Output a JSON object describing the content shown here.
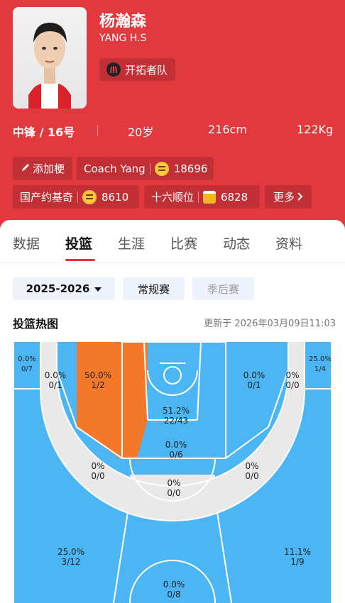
{
  "player": {
    "name_cn": "杨瀚森",
    "name_en": "YANG H.S",
    "team": "开拓者队",
    "position_number": "中锋 / 16号",
    "age": "20岁",
    "height": "216cm",
    "weight": "122Kg"
  },
  "chips": {
    "add_nickname": "添加梗",
    "coach_label": "Coach Yang",
    "coach_count": "18696",
    "nick1_label": "国产约基奇",
    "nick1_count": "8610",
    "nick2_label": "十六顺位",
    "nick2_count": "6828",
    "more": "更多"
  },
  "tabs": [
    "数据",
    "投篮",
    "生涯",
    "比赛",
    "动态",
    "资料"
  ],
  "active_tab": "投篮",
  "season_select": "2025-2026",
  "filters": [
    "常规赛",
    "季后赛"
  ],
  "section_title": "投篮热图",
  "updated": "更新于 2026年03月09日11:03",
  "colors": {
    "header_red": "#e2393f",
    "cold_blue": "#4cb6f5",
    "hot_orange": "#f47829",
    "neutral_gray": "#e9e9e9",
    "line_white": "#ffffff"
  },
  "zones": [
    {
      "id": "left-corner-3",
      "pct": "0.0%",
      "made": "0/7"
    },
    {
      "id": "left-baseline-mid",
      "pct": "0.0%",
      "made": "0/1"
    },
    {
      "id": "left-paint-side",
      "pct": "50.0%",
      "made": "1/2"
    },
    {
      "id": "restricted-area",
      "pct": "51.2%",
      "made": "22/43"
    },
    {
      "id": "right-baseline-mid",
      "pct": "0.0%",
      "made": "0/1"
    },
    {
      "id": "right-mid-corner",
      "pct": "0%",
      "made": "0/0"
    },
    {
      "id": "right-corner-3",
      "pct": "25.0%",
      "made": "1/4"
    },
    {
      "id": "paint-lane",
      "pct": "0.0%",
      "made": "0/6"
    },
    {
      "id": "left-elbow-mid",
      "pct": "0%",
      "made": "0/0"
    },
    {
      "id": "right-elbow-mid",
      "pct": "0%",
      "made": "0/0"
    },
    {
      "id": "top-key-mid",
      "pct": "0%",
      "made": "0/0"
    },
    {
      "id": "left-wing-3",
      "pct": "25.0%",
      "made": "3/12"
    },
    {
      "id": "right-wing-3",
      "pct": "11.1%",
      "made": "1/9"
    },
    {
      "id": "top-key-3",
      "pct": "0.0%",
      "made": "0/8"
    }
  ]
}
